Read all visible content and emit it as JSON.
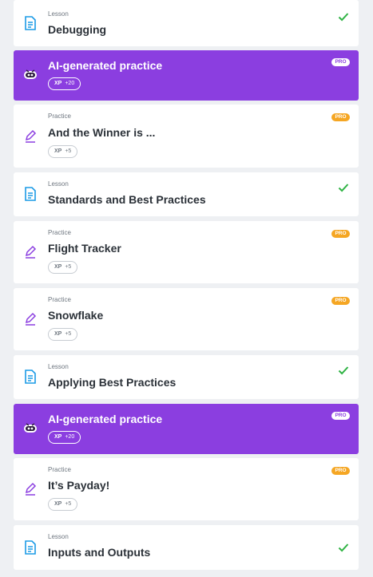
{
  "colors": {
    "accent_purple": "#8b3ee0",
    "pro_badge": "#f5a623",
    "check_green": "#2fb344",
    "lesson_icon_blue": "#1c9be6",
    "practice_icon_purple": "#8b3ee0"
  },
  "items": [
    {
      "kind": "lesson",
      "type": "Lesson",
      "title": "Debugging",
      "completed": true
    },
    {
      "kind": "ai",
      "title": "AI-generated practice",
      "xp_label": "XP",
      "xp_value": "+20",
      "badge": "PRO"
    },
    {
      "kind": "practice",
      "type": "Practice",
      "title": "And the Winner is ...",
      "xp_label": "XP",
      "xp_value": "+5",
      "badge": "PRO"
    },
    {
      "kind": "lesson",
      "type": "Lesson",
      "title": "Standards and Best Practices",
      "completed": true
    },
    {
      "kind": "practice",
      "type": "Practice",
      "title": "Flight Tracker",
      "xp_label": "XP",
      "xp_value": "+5",
      "badge": "PRO"
    },
    {
      "kind": "practice",
      "type": "Practice",
      "title": "Snowflake",
      "xp_label": "XP",
      "xp_value": "+5",
      "badge": "PRO"
    },
    {
      "kind": "lesson",
      "type": "Lesson",
      "title": "Applying Best Practices",
      "completed": true
    },
    {
      "kind": "ai",
      "title": "AI-generated practice",
      "xp_label": "XP",
      "xp_value": "+20",
      "badge": "PRO"
    },
    {
      "kind": "practice",
      "type": "Practice",
      "title": "It’s Payday!",
      "xp_label": "XP",
      "xp_value": "+5",
      "badge": "PRO"
    },
    {
      "kind": "lesson",
      "type": "Lesson",
      "title": "Inputs and Outputs",
      "completed": true
    }
  ]
}
